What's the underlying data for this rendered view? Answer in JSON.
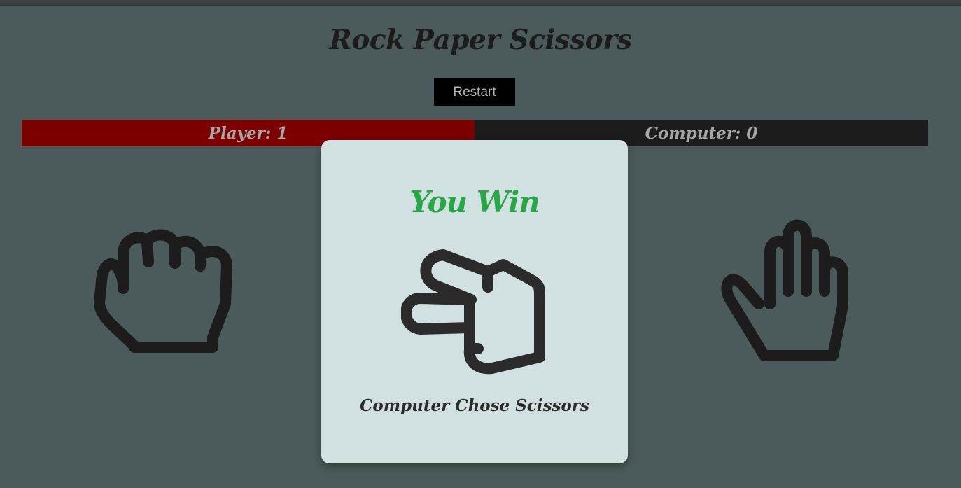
{
  "app": {
    "title": "Rock Paper Scissors",
    "restart_label": "Restart"
  },
  "scores": {
    "player_label": "Player: 1",
    "computer_label": "Computer: 0",
    "player_value": 1,
    "computer_value": 0
  },
  "choices": [
    {
      "name": "rock",
      "icon": "rock-hand-icon"
    },
    {
      "name": "scissors",
      "icon": "scissors-hand-icon"
    },
    {
      "name": "paper",
      "icon": "paper-hand-icon"
    }
  ],
  "modal": {
    "result_text": "You Win",
    "computer_choice_text": "Computer Chose Scissors",
    "computer_choice_icon": "scissors-hand-icon"
  },
  "colors": {
    "background": "#4b5b5b",
    "player_bar": "#7d0000",
    "computer_bar": "#1c1c1c",
    "win_text": "#28a745",
    "modal_bg": "#d1e0e0",
    "icon": "#1c1c1c"
  }
}
